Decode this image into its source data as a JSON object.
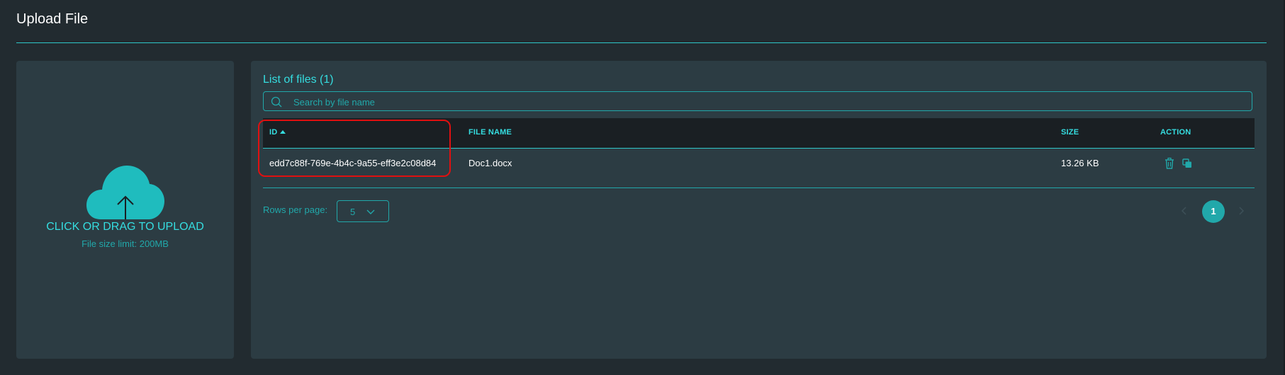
{
  "page": {
    "title": "Upload File"
  },
  "upload": {
    "label": "CLICK OR DRAG TO UPLOAD",
    "limit": "File size limit: 200MB",
    "icon": "cloud-upload-icon"
  },
  "files": {
    "title": "List of files (1)",
    "search": {
      "placeholder": "Search by file name",
      "value": ""
    },
    "columns": {
      "id": "ID",
      "file_name": "FILE NAME",
      "size": "SIZE",
      "action": "ACTION"
    },
    "sort": {
      "column": "ID",
      "direction": "ascending"
    },
    "rows": [
      {
        "id": "edd7c88f-769e-4b4c-9a55-eff3e2c08d84",
        "file_name": "Doc1.docx",
        "size": "13.26 KB",
        "actions": [
          "trash-icon",
          "copy-icon"
        ]
      }
    ]
  },
  "pagination": {
    "rows_per_page_label": "Rows per page:",
    "rows_per_page": "5",
    "current_page": "1"
  },
  "colors": {
    "background": "#222b30",
    "panel": "#2c3c43",
    "accent": "#35dde0",
    "accent_dim": "#21a8aa",
    "header_bg": "#1a1f23",
    "highlight": "#e01010"
  }
}
